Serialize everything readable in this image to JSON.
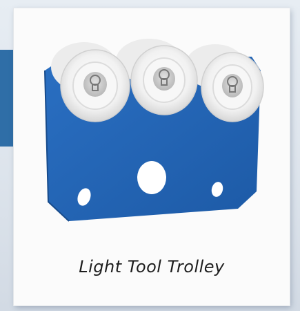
{
  "product": {
    "caption": "Light Tool Trolley",
    "plate_color": "#2366b8",
    "roller_color": "#f2f2f2",
    "icons": [
      "trolley-plate",
      "roller-wheel",
      "bolt-icon",
      "mount-hole"
    ]
  }
}
